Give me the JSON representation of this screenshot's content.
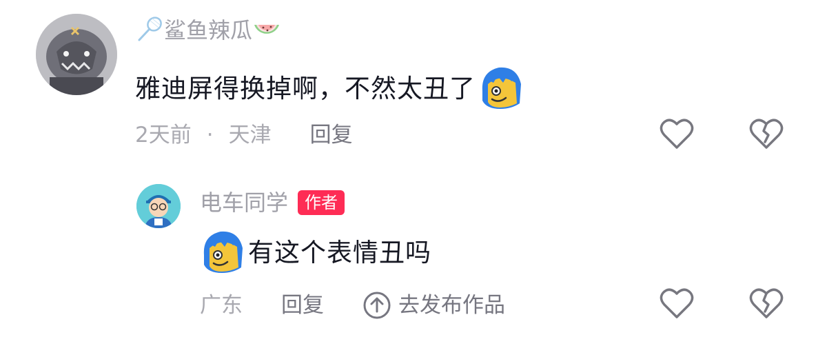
{
  "comment": {
    "username": "鲨鱼辣瓜",
    "text": "雅迪屏得换掉啊，不然太丑了",
    "time": "2天前",
    "separator": "·",
    "location": "天津",
    "reply_label": "回复",
    "username_decor_left": "badminton-racket-icon",
    "username_decor_right": "watermelon-icon",
    "emoji": "blue-hair-face-emoji"
  },
  "reply": {
    "username": "电车同学",
    "author_badge": "作者",
    "text": "有这个表情丑吗",
    "location": "广东",
    "reply_label": "回复",
    "go_publish_label": "去发布作品",
    "emoji": "blue-hair-face-emoji"
  },
  "colors": {
    "badge": "#fe2c55",
    "text": "#161823",
    "muted": "#a0a0a8"
  }
}
